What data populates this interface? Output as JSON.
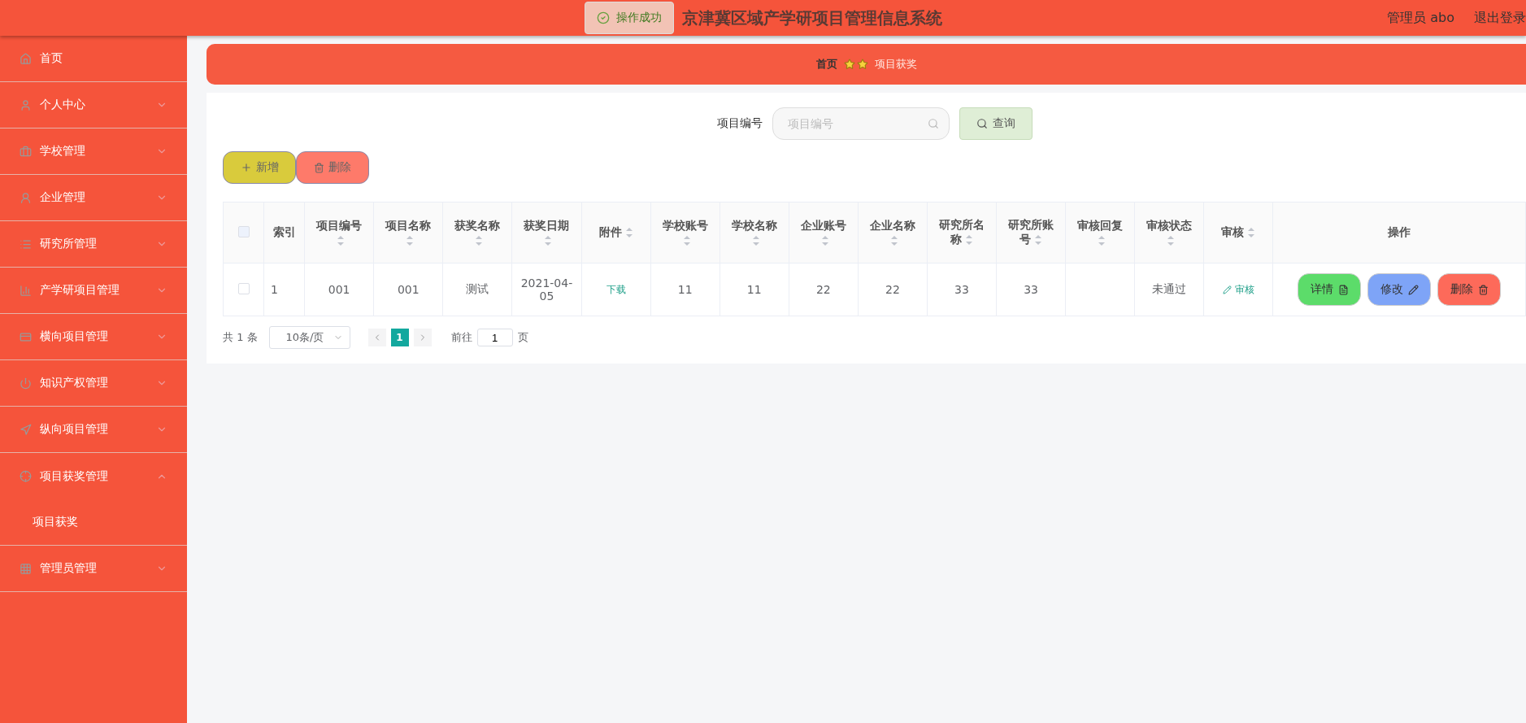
{
  "header": {
    "title": "京津冀区域产学研项目管理信息系统",
    "user": "管理员 abo",
    "logout": "退出登录"
  },
  "toast": {
    "text": "操作成功"
  },
  "sidebar": {
    "items": [
      {
        "label": "首页",
        "expandable": false
      },
      {
        "label": "个人中心",
        "expandable": true,
        "expanded": false
      },
      {
        "label": "学校管理",
        "expandable": true,
        "expanded": false
      },
      {
        "label": "企业管理",
        "expandable": true,
        "expanded": false
      },
      {
        "label": "研究所管理",
        "expandable": true,
        "expanded": false
      },
      {
        "label": "产学研项目管理",
        "expandable": true,
        "expanded": false
      },
      {
        "label": "横向项目管理",
        "expandable": true,
        "expanded": false
      },
      {
        "label": "知识产权管理",
        "expandable": true,
        "expanded": false
      },
      {
        "label": "纵向项目管理",
        "expandable": true,
        "expanded": false
      },
      {
        "label": "项目获奖管理",
        "expandable": true,
        "expanded": true,
        "children": [
          {
            "label": "项目获奖"
          }
        ]
      },
      {
        "label": "管理员管理",
        "expandable": true,
        "expanded": false
      }
    ]
  },
  "breadcrumb": [
    "首页",
    "项目获奖"
  ],
  "search": {
    "label": "项目编号",
    "placeholder": "项目编号",
    "button": "查询"
  },
  "toolbar": [
    {
      "label": "新增",
      "kind": "add"
    },
    {
      "label": "删除",
      "kind": "delete"
    }
  ],
  "table": {
    "select_all_checked": false,
    "columns": [
      {
        "label": "索引",
        "sortable": false
      },
      {
        "label": "项目编号",
        "sortable": true
      },
      {
        "label": "项目名称",
        "sortable": true
      },
      {
        "label": "获奖名称",
        "sortable": true
      },
      {
        "label": "获奖日期",
        "sortable": true
      },
      {
        "label": "附件",
        "sortable": true
      },
      {
        "label": "学校账号",
        "sortable": true
      },
      {
        "label": "学校名称",
        "sortable": true
      },
      {
        "label": "企业账号",
        "sortable": true
      },
      {
        "label": "企业名称",
        "sortable": true
      },
      {
        "label": "研究所名称",
        "sortable": true
      },
      {
        "label": "研究所账号",
        "sortable": true
      },
      {
        "label": "审核回复",
        "sortable": true
      },
      {
        "label": "审核状态",
        "sortable": true
      },
      {
        "label": "审核",
        "sortable": true
      },
      {
        "label": "操作",
        "sortable": false
      }
    ],
    "rows": [
      {
        "checked": false,
        "cells": [
          {
            "kind": "text",
            "text": "1"
          },
          {
            "kind": "text",
            "text": "001"
          },
          {
            "kind": "text",
            "text": "001"
          },
          {
            "kind": "text",
            "text": "测试"
          },
          {
            "kind": "text",
            "text": "2021-04-05"
          },
          {
            "kind": "link",
            "text": "下载"
          },
          {
            "kind": "text",
            "text": "11"
          },
          {
            "kind": "text",
            "text": "11"
          },
          {
            "kind": "text",
            "text": "22"
          },
          {
            "kind": "text",
            "text": "22"
          },
          {
            "kind": "text",
            "text": "33"
          },
          {
            "kind": "text",
            "text": "33"
          },
          {
            "kind": "empty"
          },
          {
            "kind": "text",
            "text": "未通过"
          },
          {
            "kind": "audit",
            "text": "审核"
          }
        ],
        "actions": [
          {
            "label": "详情",
            "kind": "detail"
          },
          {
            "label": "修改",
            "kind": "edit"
          },
          {
            "label": "删除",
            "kind": "delete"
          }
        ]
      }
    ]
  },
  "pagination": {
    "total": "共 1 条",
    "page_size": "10条/页",
    "pages": [
      {
        "label": "1",
        "selected": true
      }
    ],
    "goto": "前往",
    "goto_value": "1",
    "page_unit": "页"
  }
}
